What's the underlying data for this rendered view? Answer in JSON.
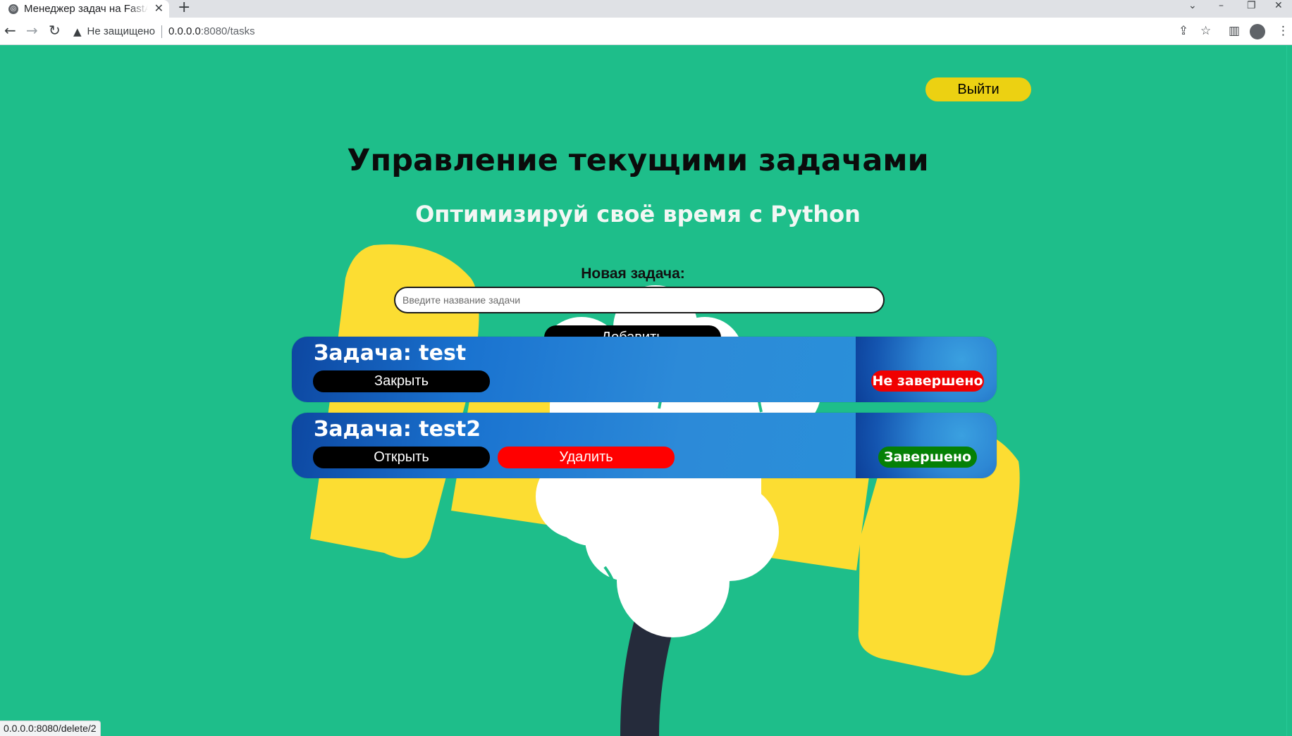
{
  "browser": {
    "tab_title": "Менеджер задач на FastAPI",
    "url_security": "Не защищено",
    "url_host": "0.0.0.0",
    "url_path": ":8080/tasks",
    "status_url": "0.0.0.0:8080/delete/2"
  },
  "header": {
    "logout_label": "Выйти",
    "title": "Управление текущими задачами",
    "subtitle": "Оптимизируй своё время с Python"
  },
  "new_task": {
    "label": "Новая задача:",
    "placeholder": "Введите название задачи",
    "add_label": "Добавить"
  },
  "tasks": [
    {
      "name": "Задача: test",
      "toggle_label": "Закрыть",
      "status": "Не завершено",
      "status_color": "#f00000"
    },
    {
      "name": "Задача: test2",
      "toggle_label": "Открыть",
      "delete_label": "Удалить",
      "status": "Завершено",
      "status_color": "#058005"
    }
  ],
  "colors": {
    "page_background": "#1ebe8a",
    "logout_button": "#ecd112",
    "card_gradient_start": "#0d47a1",
    "card_gradient_end": "#3396dc",
    "delete_button": "#ff0000"
  }
}
